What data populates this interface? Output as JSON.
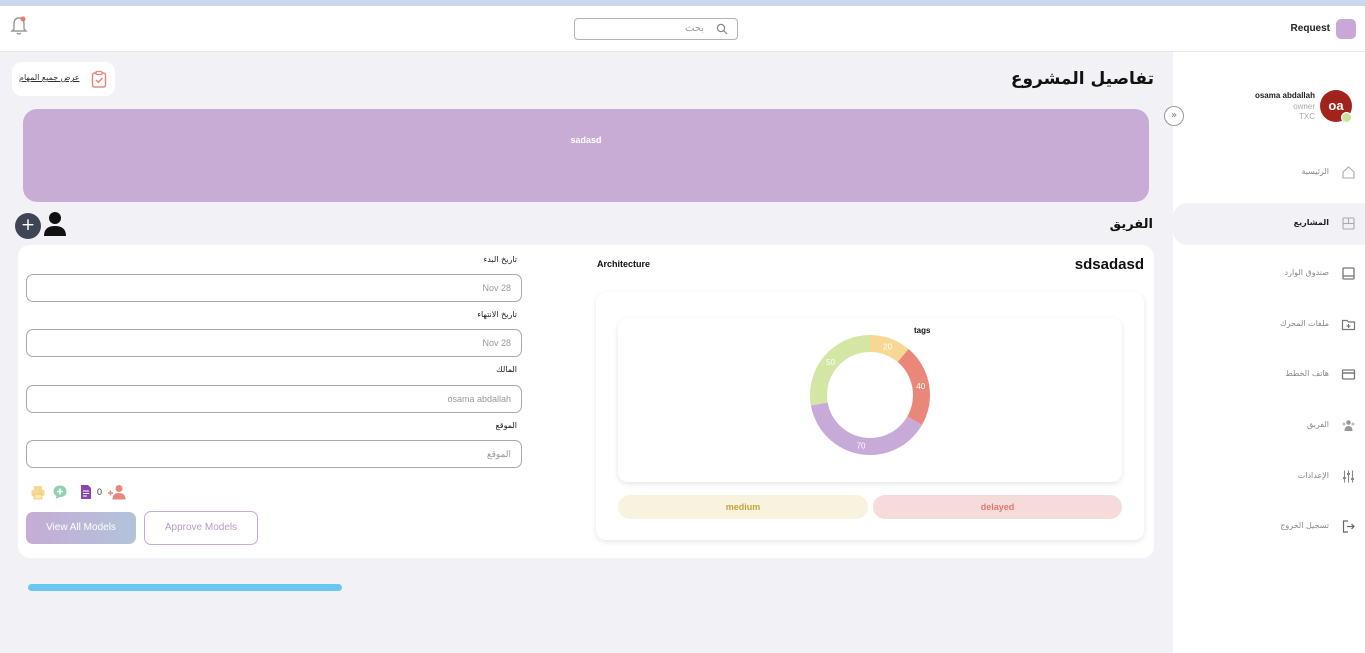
{
  "header": {
    "search_placeholder": "بحث",
    "request_label": "Request"
  },
  "user": {
    "name": "osama abdallah",
    "role": "owner",
    "org": "TXC",
    "initials": "oa"
  },
  "sidebar": {
    "items": [
      {
        "label": "الرئيسية",
        "icon": "home-icon"
      },
      {
        "label": "المشاريع",
        "icon": "projects-icon",
        "active": true
      },
      {
        "label": "صندوق الوارد",
        "icon": "inbox-icon"
      },
      {
        "label": "ملفات المحرك",
        "icon": "folder-icon"
      },
      {
        "label": "هاتف الخطط",
        "icon": "card-icon"
      },
      {
        "label": "الفريق",
        "icon": "team-icon"
      },
      {
        "label": "الإعدادات",
        "icon": "settings-icon"
      },
      {
        "label": "تسجيل الخروج",
        "icon": "logout-icon"
      }
    ]
  },
  "page": {
    "title": "تفاصيل المشروع",
    "all_tasks_link": "عرض جميع المهام",
    "banner_text": "sadasd",
    "team_title": "الفريق"
  },
  "details": {
    "start_label": "تاريخ البدء",
    "start_value": "Nov 28",
    "end_label": "تاريخ الانتهاء",
    "end_value": "Nov 28",
    "owner_label": "المالك",
    "owner_value": "osama abdallah",
    "location_label": "الموقع",
    "location_placeholder": "الموقع",
    "member_count": "0",
    "view_models_label": "View All Models",
    "approve_models_label": "Approve Models"
  },
  "project": {
    "name": "sdsadasd",
    "type": "Architecture",
    "priority": "medium",
    "status": "delayed"
  },
  "colors": {
    "banner": "#c8acd6",
    "progress": "#6cc6ee",
    "medium": "#c9a23a",
    "delayed": "#e27b6e"
  },
  "chart_data": {
    "type": "pie",
    "title": "tags",
    "slices": [
      {
        "value": 20,
        "color": "#f7d794"
      },
      {
        "value": 40,
        "color": "#e8877a"
      },
      {
        "value": 70,
        "color": "#c8aad9"
      },
      {
        "value": 50,
        "color": "#d3e6a4"
      }
    ]
  }
}
